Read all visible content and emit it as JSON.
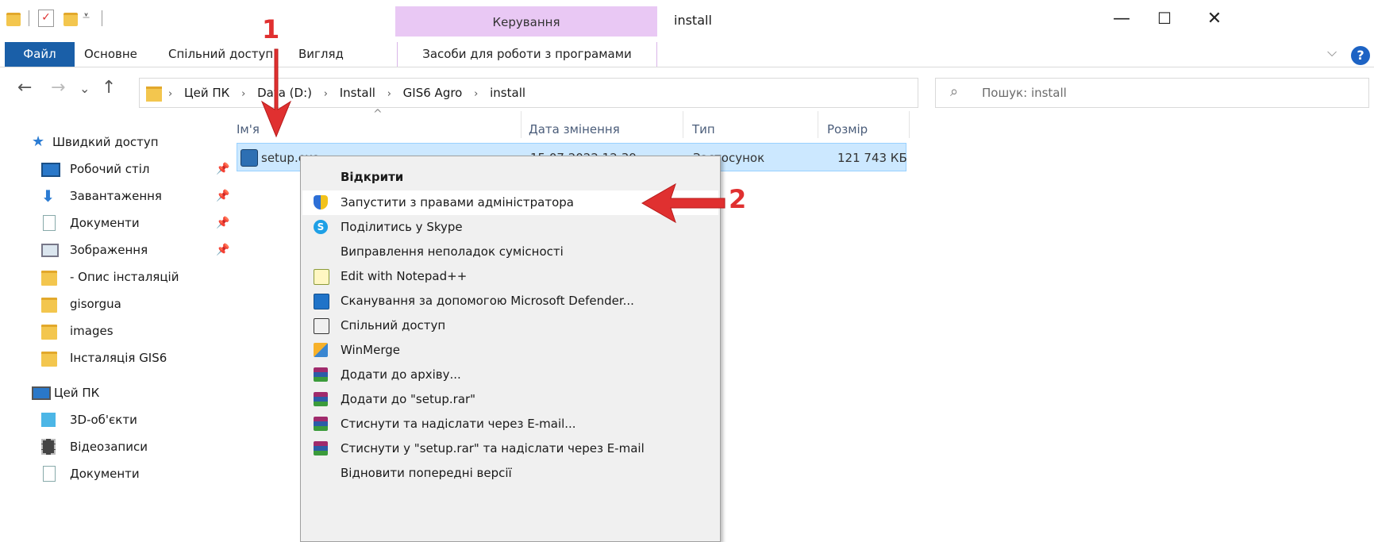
{
  "window": {
    "title": "install",
    "context_band": "Керування",
    "controls": {
      "minimize": "—",
      "maximize": "☐",
      "close": "✕"
    }
  },
  "ribbon": {
    "tabs": [
      "Файл",
      "Основне",
      "Спільний доступ",
      "Вигляд"
    ],
    "context_tab": "Засоби для роботи з програмами",
    "help": "?",
    "collapse": "⌵"
  },
  "navigation": {
    "back": "←",
    "forward": "→",
    "recent": "⌄",
    "up": "↑",
    "breadcrumb": [
      "Цей ПК",
      "Data (D:)",
      "Install",
      "GIS6 Agro",
      "install"
    ],
    "breadcrumb_sep": "›",
    "dropdown": "⌄",
    "refresh": "↻"
  },
  "search": {
    "placeholder": "Пошук: install",
    "icon": "⌕"
  },
  "sidebar": {
    "quick_access": "Швидкий доступ",
    "items": [
      {
        "label": "Робочий стіл",
        "icon": "desktop-icon",
        "pinned": true
      },
      {
        "label": "Завантаження",
        "icon": "download-arrow-icon",
        "pinned": true
      },
      {
        "label": "Документи",
        "icon": "document-icon",
        "pinned": true
      },
      {
        "label": "Зображення",
        "icon": "pictures-icon",
        "pinned": true
      },
      {
        "label": "- Опис інсталяцій",
        "icon": "folder-icon",
        "pinned": false
      },
      {
        "label": "gisorgua",
        "icon": "folder-icon",
        "pinned": false
      },
      {
        "label": "images",
        "icon": "folder-icon",
        "pinned": false
      },
      {
        "label": "Інсталяція GIS6",
        "icon": "folder-icon",
        "pinned": false
      }
    ],
    "this_pc": "Цей ПК",
    "pc_items": [
      {
        "label": "3D-об'єкти",
        "icon": "cube-3d-icon"
      },
      {
        "label": "Відеозаписи",
        "icon": "film-icon"
      },
      {
        "label": "Документи",
        "icon": "document-icon"
      }
    ],
    "pin_glyph": "📌"
  },
  "file_list": {
    "columns": [
      "Ім'я",
      "Дата змінення",
      "Тип",
      "Розмір"
    ],
    "sort_indicator": "^",
    "rows": [
      {
        "name": "setup.exe",
        "date": "15.07.2022 12:39",
        "type": "Застосунок",
        "size": "121 743 КБ"
      }
    ]
  },
  "context_menu": {
    "items": [
      {
        "label": "Відкрити",
        "bold": true,
        "icon": ""
      },
      {
        "label": "Запустити з правами адміністратора",
        "icon": "uac-shield-icon",
        "highlight": true
      },
      {
        "label": "Поділитись у Skype",
        "icon": "skype-icon"
      },
      {
        "label": "Виправлення неполадок сумісності",
        "icon": ""
      },
      {
        "label": "Edit with Notepad++",
        "icon": "notepad-plus-icon"
      },
      {
        "label": "Сканування за допомогою Microsoft Defender...",
        "icon": "defender-icon"
      },
      {
        "label": "Спільний доступ",
        "icon": "share-icon"
      },
      {
        "label": "WinMerge",
        "icon": "winmerge-icon"
      },
      {
        "label": "Додати до архіву...",
        "icon": "winrar-icon"
      },
      {
        "label": "Додати до \"setup.rar\"",
        "icon": "winrar-icon"
      },
      {
        "label": "Стиснути та надіслати через E-mail...",
        "icon": "winrar-icon"
      },
      {
        "label": "Стиснути у \"setup.rar\" та надіслати через E-mail",
        "icon": "winrar-icon"
      },
      {
        "label": "Відновити попередні версії",
        "icon": ""
      }
    ]
  },
  "annotations": {
    "step1": "1",
    "step2": "2",
    "color": "#e03030"
  },
  "colors": {
    "file_tab": "#1a5fa8",
    "manage_band": "#e9c8f4",
    "selection": "#cce8ff",
    "accent": "#1d63c4"
  }
}
